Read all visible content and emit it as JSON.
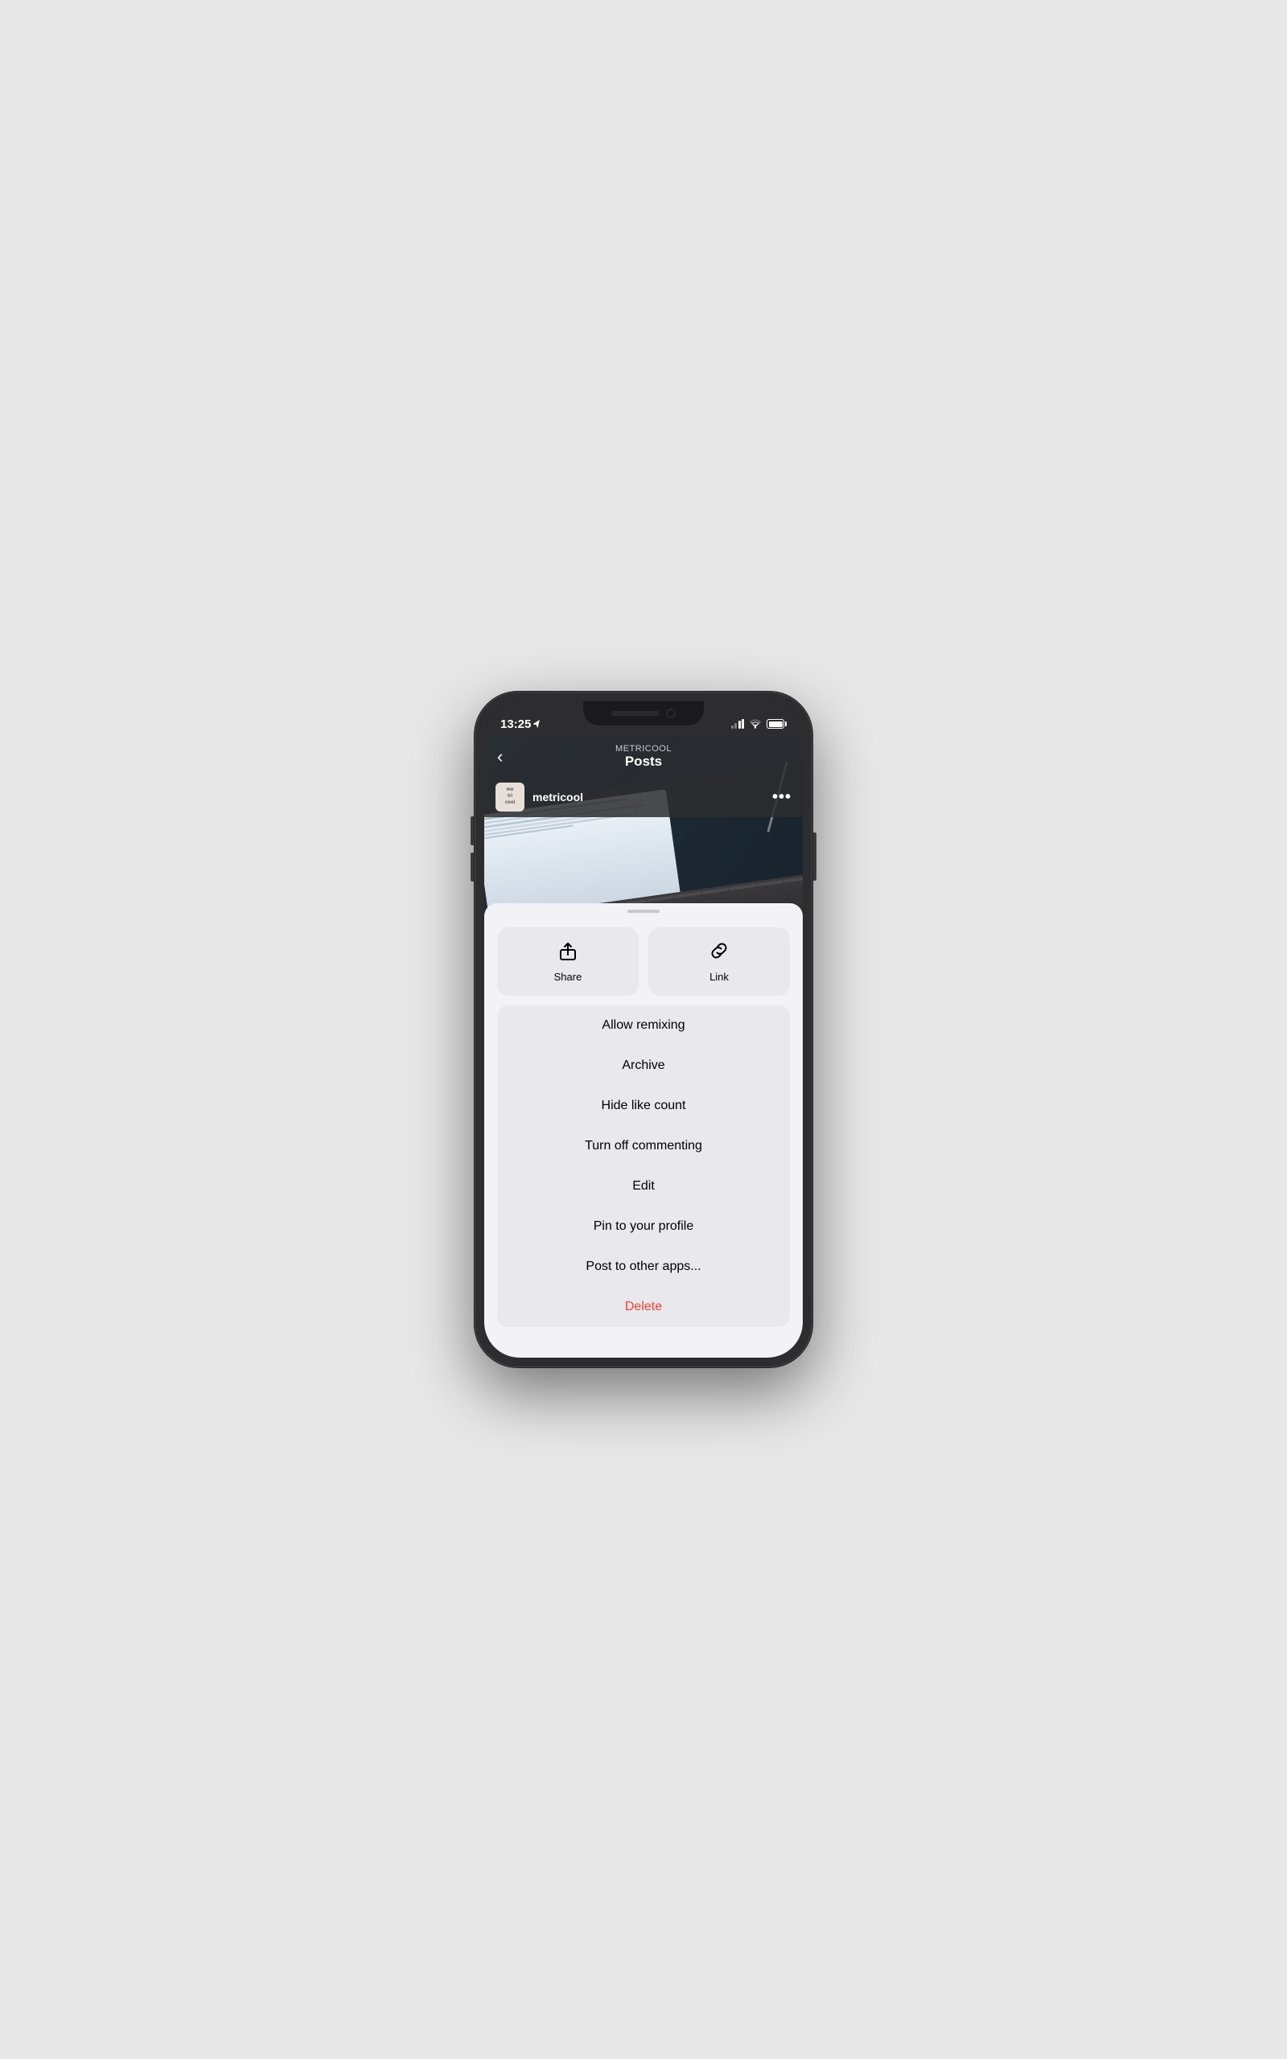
{
  "phone": {
    "status_bar": {
      "time": "13:25",
      "location_arrow": "▲"
    },
    "nav": {
      "back_label": "‹",
      "subtitle": "METRICOOL",
      "title": "Posts"
    },
    "post": {
      "username": "metricool",
      "avatar_lines": [
        "me",
        "tri",
        "cool"
      ],
      "more_icon": "•••"
    },
    "bottom_sheet": {
      "handle_label": "",
      "action_buttons": [
        {
          "id": "share",
          "label": "Share"
        },
        {
          "id": "link",
          "label": "Link"
        }
      ],
      "menu_items": [
        {
          "id": "allow-remixing",
          "label": "Allow remixing",
          "type": "normal"
        },
        {
          "id": "archive",
          "label": "Archive",
          "type": "normal"
        },
        {
          "id": "hide-like-count",
          "label": "Hide like count",
          "type": "normal"
        },
        {
          "id": "turn-off-commenting",
          "label": "Turn off commenting",
          "type": "normal"
        },
        {
          "id": "edit",
          "label": "Edit",
          "type": "normal"
        },
        {
          "id": "pin-to-profile",
          "label": "Pin to your profile",
          "type": "normal"
        },
        {
          "id": "post-to-other-apps",
          "label": "Post to other apps...",
          "type": "normal"
        },
        {
          "id": "delete",
          "label": "Delete",
          "type": "delete"
        }
      ]
    }
  }
}
